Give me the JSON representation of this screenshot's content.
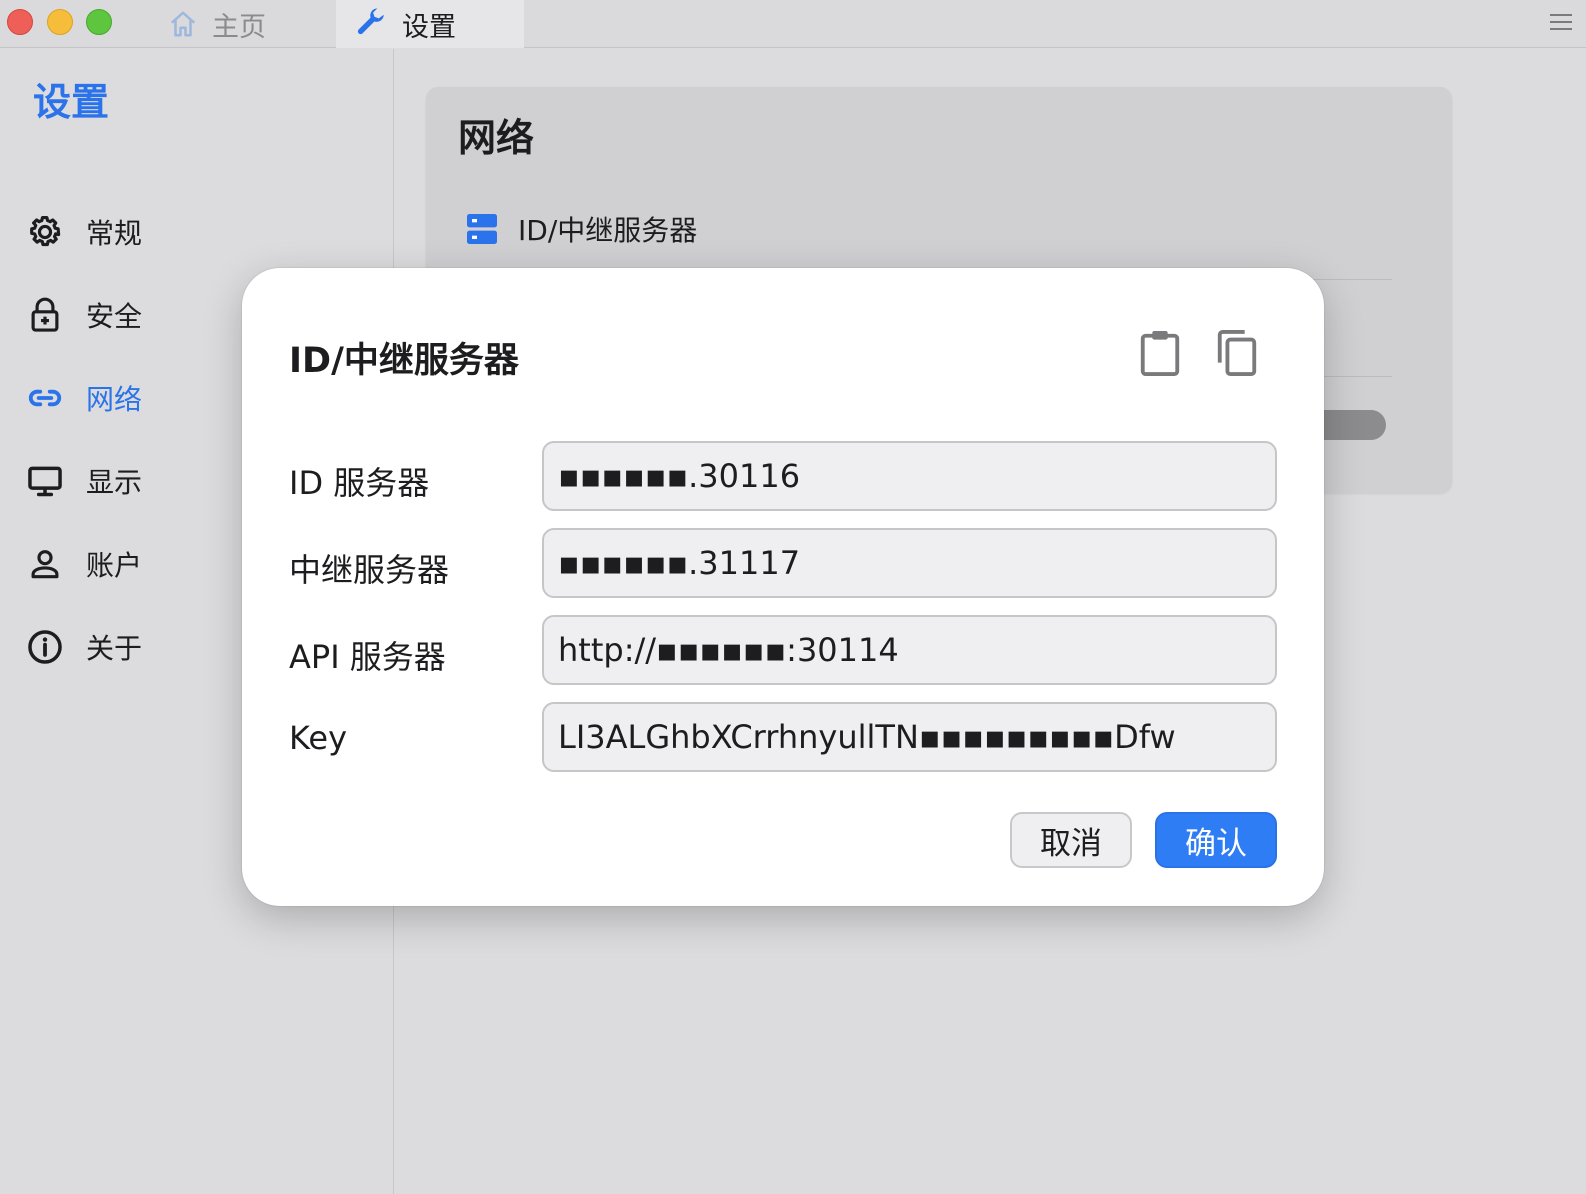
{
  "titlebar": {
    "tabs": [
      {
        "label": "主页",
        "icon": "home-icon"
      },
      {
        "label": "设置",
        "icon": "wrench-icon"
      }
    ]
  },
  "sidebar": {
    "title": "设置",
    "items": [
      {
        "label": "常规",
        "icon": "gear-icon"
      },
      {
        "label": "安全",
        "icon": "lock-icon"
      },
      {
        "label": "网络",
        "icon": "link-icon",
        "active": true
      },
      {
        "label": "显示",
        "icon": "monitor-icon"
      },
      {
        "label": "账户",
        "icon": "user-icon"
      },
      {
        "label": "关于",
        "icon": "info-icon"
      }
    ]
  },
  "main": {
    "card": {
      "title": "网络",
      "row_label": "ID/中继服务器"
    }
  },
  "dialog": {
    "title": "ID/中继服务器",
    "fields": [
      {
        "label": "ID 服务器",
        "value": "▪︎▪︎▪︎▪︎▪︎▪︎.30116"
      },
      {
        "label": "中继服务器",
        "value": "▪︎▪︎▪︎▪︎▪︎▪︎.31117"
      },
      {
        "label": "API 服务器",
        "value": "http://▪︎▪︎▪︎▪︎▪︎▪︎:30114"
      },
      {
        "label": "Key",
        "value": "LI3ALGhbXCrrhnyullTN▪︎▪︎▪︎▪︎▪︎▪︎▪︎▪︎▪︎Dfw"
      }
    ],
    "cancel_label": "取消",
    "confirm_label": "确认"
  },
  "colors": {
    "accent": "#2b73ea",
    "confirm_button": "#2f7df5"
  }
}
